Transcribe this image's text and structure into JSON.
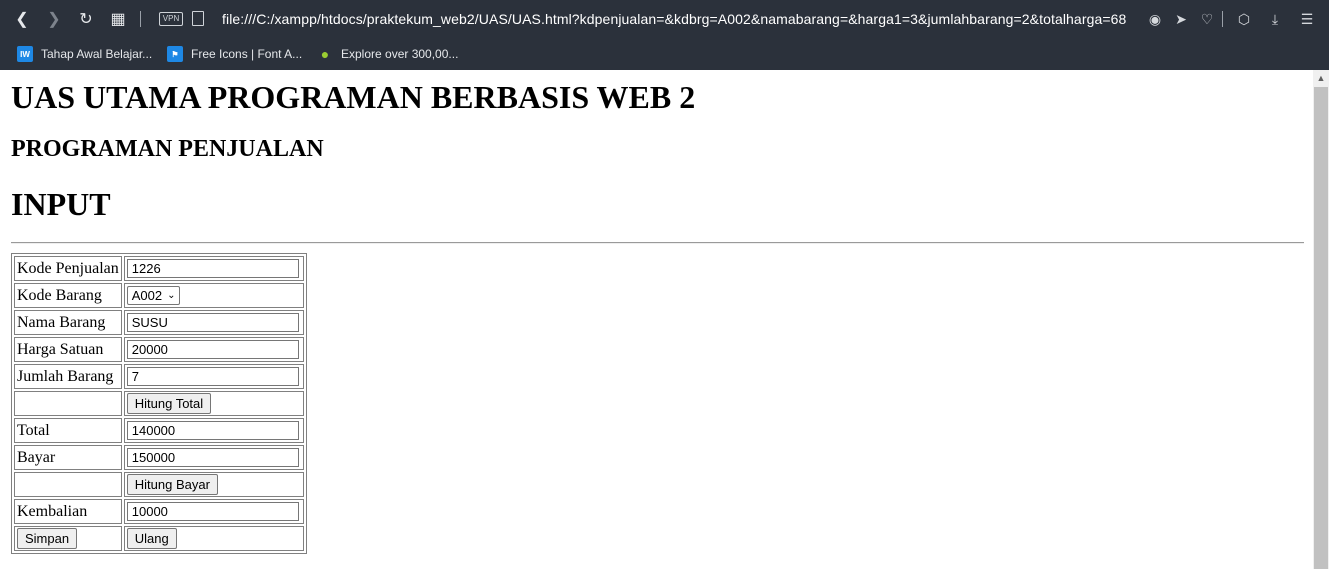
{
  "browser": {
    "url": "file:///C:/xampp/htdocs/praktekum_web2/UAS/UAS.html?kdpenjualan=&kdbrg=A002&namabarang=&harga1=3&jumlahbarang=2&totalharga=68",
    "vpn_label": "VPN",
    "bookmarks": [
      {
        "label": "Tahap Awal Belajar...",
        "icon_text": "IW",
        "color": "#1e88e5"
      },
      {
        "label": "Free Icons | Font A...",
        "icon_text": "⚑",
        "color": "#1e88e5"
      },
      {
        "label": "Explore over 300,00...",
        "icon_text": "●",
        "color": "#9acd32"
      }
    ]
  },
  "page": {
    "title": "UAS UTAMA PROGRAMAN BERBASIS WEB 2",
    "subtitle": "PROGRAMAN PENJUALAN",
    "section": "INPUT"
  },
  "form": {
    "kode_penjualan": {
      "label": "Kode Penjualan",
      "value": "1226"
    },
    "kode_barang": {
      "label": "Kode Barang",
      "value": "A002"
    },
    "nama_barang": {
      "label": "Nama Barang",
      "value": "SUSU"
    },
    "harga_satuan": {
      "label": "Harga Satuan",
      "value": "20000"
    },
    "jumlah_barang": {
      "label": "Jumlah Barang",
      "value": "7"
    },
    "hitung_total": "Hitung Total",
    "total": {
      "label": "Total",
      "value": "140000"
    },
    "bayar": {
      "label": "Bayar",
      "value": "150000"
    },
    "hitung_bayar": "Hitung Bayar",
    "kembalian": {
      "label": "Kembalian",
      "value": "10000"
    },
    "simpan": "Simpan",
    "ulang": "Ulang"
  }
}
